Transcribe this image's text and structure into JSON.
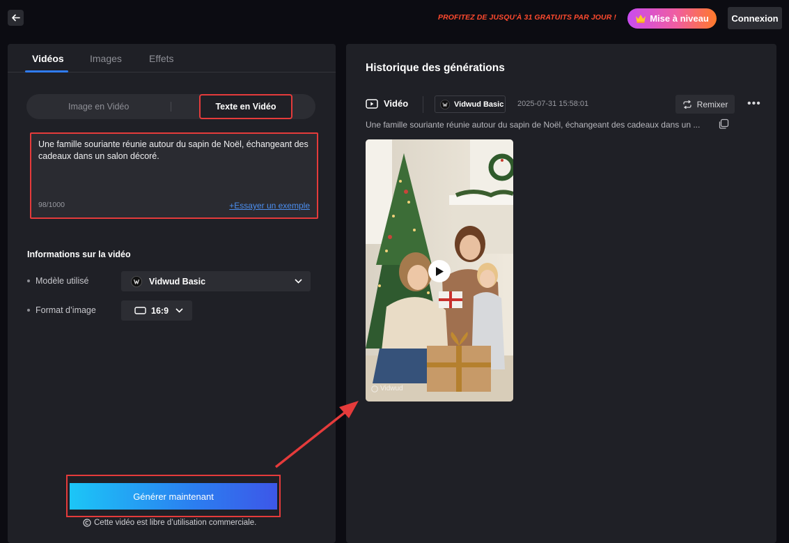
{
  "topbar": {
    "promo": "PROFITEZ DE JUSQU'À 31 GRATUITS PAR JOUR !",
    "upgrade_label": "Mise à niveau",
    "login_label": "Connexion"
  },
  "left": {
    "tabs": [
      {
        "label": "Vidéos"
      },
      {
        "label": "Images"
      },
      {
        "label": "Effets"
      }
    ],
    "modes": {
      "image_to_video": "Image en Vidéo",
      "text_to_video": "Texte en Vidéo"
    },
    "prompt": {
      "value": "Une famille souriante réunie autour du sapin de Noël, échangeant des cadeaux dans un salon décoré.",
      "count": "98/1000",
      "example_link": "+Essayer un exemple"
    },
    "info": {
      "title": "Informations sur la vidéo",
      "model_label": "Modèle utilisé",
      "model_value": "Vidwud Basic",
      "format_label": "Format d’image",
      "format_value": "16:9"
    },
    "generate_label": "Générer maintenant",
    "license_note": "Cette vidéo est libre d’utilisation commerciale."
  },
  "right": {
    "title": "Historique des générations",
    "type_label": "Vidéo",
    "model_chip": "Vidwud Basic",
    "timestamp": "2025-07-31 15:58:01",
    "remix_label": "Remixer",
    "prompt_preview": "Une famille souriante réunie autour du sapin de Noël, échangeant des cadeaux dans un ...",
    "watermark": "Vidwud"
  },
  "colors": {
    "accent_blue": "#2f7cf6",
    "highlight_red": "#e53b3b",
    "promo_red": "#ff4a2e"
  }
}
